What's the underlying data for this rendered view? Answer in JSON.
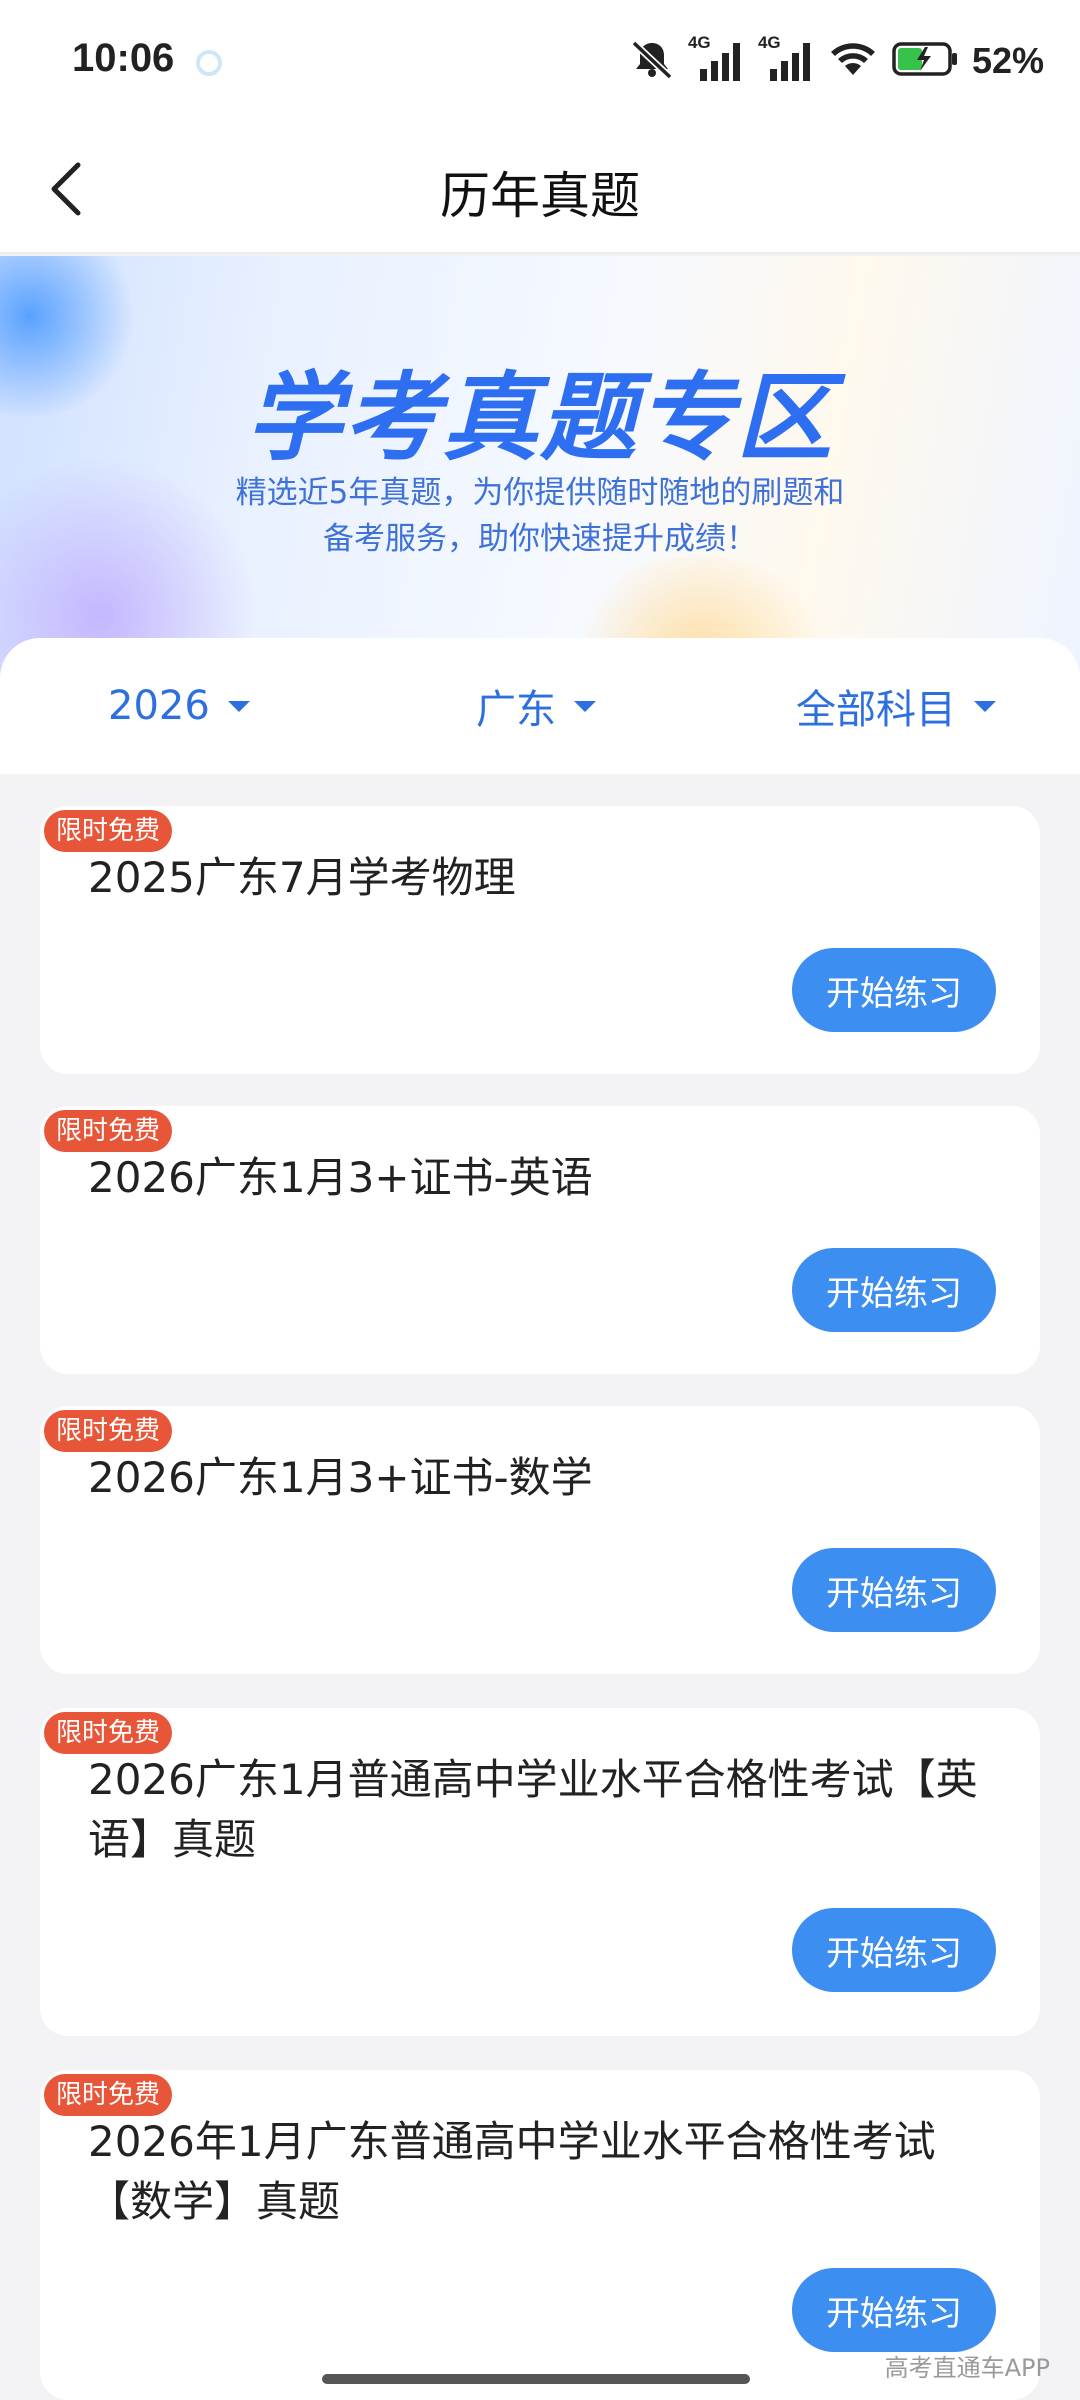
{
  "status_bar": {
    "time": "10:06",
    "network_1": "4G",
    "network_2": "4G",
    "battery": "52%",
    "icons": [
      "mute-icon",
      "signal-icon",
      "signal-icon",
      "wifi-icon",
      "battery-charging-icon"
    ]
  },
  "header": {
    "title": "历年真题",
    "back_icon": "chevron-left-icon"
  },
  "banner": {
    "title": "学考真题专区",
    "subtitle_line1": "精选近5年真题，为你提供随时随地的刷题和",
    "subtitle_line2": "备考服务，助你快速提升成绩！"
  },
  "filters": {
    "year": "2026",
    "region": "广东",
    "subject": "全部科目"
  },
  "papers": [
    {
      "tag": "限时免费",
      "title": "2025广东7月学考物理",
      "button": "开始练习"
    },
    {
      "tag": "限时免费",
      "title": "2026广东1月3+证书-英语",
      "button": "开始练习"
    },
    {
      "tag": "限时免费",
      "title": "2026广东1月3+证书-数学",
      "button": "开始练习"
    },
    {
      "tag": "限时免费",
      "title": "2026广东1月普通高中学业水平合格性考试【英语】真题",
      "button": "开始练习"
    },
    {
      "tag": "限时免费",
      "title": "2026年1月广东普通高中学业水平合格性考试【数学】真题",
      "button": "开始练习"
    }
  ],
  "watermark": "高考直通车APP",
  "colors": {
    "accent": "#3c8ff0",
    "tag": "#e8563a",
    "filter_text": "#2e6fe0",
    "banner_title": "#2d6ff0"
  }
}
